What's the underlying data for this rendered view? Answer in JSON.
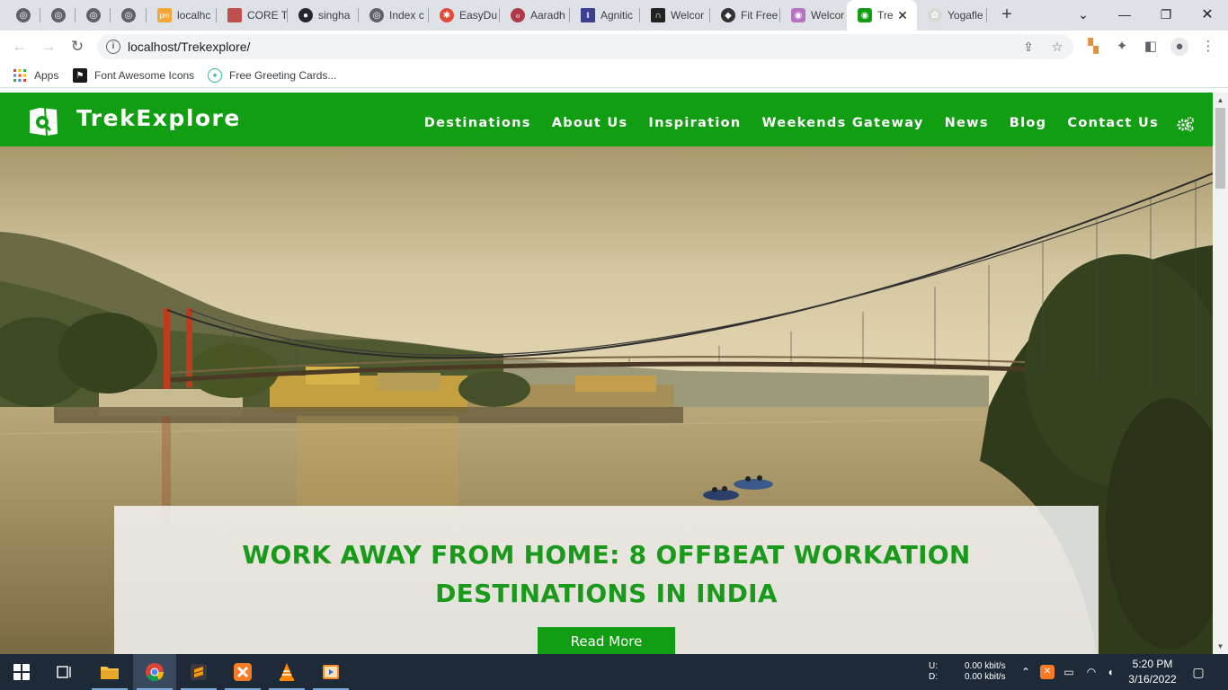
{
  "browser": {
    "tabs": [
      {
        "label": "",
        "icon": "globe-icon"
      },
      {
        "label": "",
        "icon": "globe-icon"
      },
      {
        "label": "",
        "icon": "globe-icon"
      },
      {
        "label": "",
        "icon": "globe-icon"
      },
      {
        "label": "localhc",
        "icon": "phpmyadmin-icon"
      },
      {
        "label": "CORE T",
        "icon": "core-icon"
      },
      {
        "label": "singha",
        "icon": "github-icon"
      },
      {
        "label": "Index c",
        "icon": "globe-icon"
      },
      {
        "label": "EasyDu",
        "icon": "easydu-icon"
      },
      {
        "label": "Aaradh",
        "icon": "aaradh-icon"
      },
      {
        "label": "Agnitic",
        "icon": "agnitic-icon"
      },
      {
        "label": "Welcor",
        "icon": "arch-icon"
      },
      {
        "label": "Fit Free",
        "icon": "fit-icon"
      },
      {
        "label": "Welcor",
        "icon": "camera-icon"
      },
      {
        "label": "Tre",
        "icon": "trek-icon",
        "active": true
      },
      {
        "label": "Yogafle",
        "icon": "yoga-icon"
      }
    ],
    "url": "localhost/Trekexplore/",
    "bookmarks": [
      {
        "label": "Apps",
        "icon": "apps-grid-icon"
      },
      {
        "label": "Font Awesome Icons",
        "icon": "flag-icon"
      },
      {
        "label": "Free Greeting Cards...",
        "icon": "greeting-icon"
      }
    ]
  },
  "site": {
    "brand": "TrekExplore",
    "nav": [
      "Destinations",
      "About Us",
      "Inspiration",
      "Weekends Gateway",
      "News",
      "Blog",
      "Contact Us"
    ],
    "hero": {
      "title_line1": "WORK AWAY FROM HOME: 8 OFFBEAT WORKATION",
      "title_line2": "DESTINATIONS IN INDIA",
      "button": "Read More"
    },
    "colors": {
      "brand_green": "#129e12",
      "title_green": "#1a9a1a"
    }
  },
  "taskbar": {
    "net_up_label": "U:",
    "net_down_label": "D:",
    "net_up": "0.00 kbit/s",
    "net_down": "0.00 kbit/s",
    "time": "5:20 PM",
    "date": "3/16/2022"
  }
}
